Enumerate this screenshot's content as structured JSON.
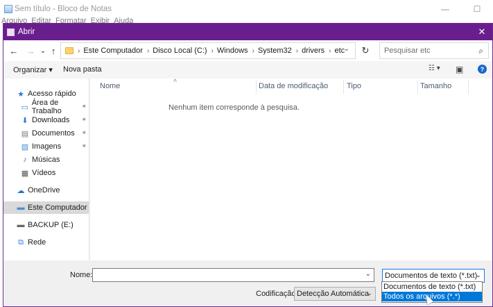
{
  "background_window": {
    "title": "Sem título - Bloco de Notas",
    "menu": [
      "Arquivo",
      "Editar",
      "Formatar",
      "Exibir",
      "Ajuda"
    ],
    "controls": [
      "—",
      "☐"
    ]
  },
  "dialog": {
    "title": "Abrir",
    "close_glyph": "✕",
    "accent": "#6a1e8e"
  },
  "nav": {
    "back": "←",
    "forward": "→",
    "recent": "⌄",
    "up": "↑",
    "breadcrumbs": [
      "Este Computador",
      "Disco Local (C:)",
      "Windows",
      "System32",
      "drivers",
      "etc"
    ],
    "separator": "›",
    "refresh": "↻",
    "search_placeholder": "Pesquisar etc",
    "search_icon": "⌕"
  },
  "toolbar": {
    "organize": "Organizar ▾",
    "new_folder": "Nova pasta",
    "view_icon": "☷ ▾",
    "pane_icon": "▣",
    "help_glyph": "?"
  },
  "sidebar": {
    "items": [
      {
        "label": "Acesso rápido",
        "icon": "★",
        "pinned": false
      },
      {
        "label": "Área de Trabalho",
        "icon": "▭",
        "pinned": true
      },
      {
        "label": "Downloads",
        "icon": "⬇",
        "pinned": true
      },
      {
        "label": "Documentos",
        "icon": "▤",
        "pinned": true
      },
      {
        "label": "Imagens",
        "icon": "▨",
        "pinned": true
      },
      {
        "label": "Músicas",
        "icon": "♪",
        "pinned": false
      },
      {
        "label": "Vídeos",
        "icon": "▦",
        "pinned": false
      },
      {
        "label": "OneDrive",
        "icon": "☁",
        "pinned": false
      },
      {
        "label": "Este Computador",
        "icon": "▬",
        "pinned": false
      },
      {
        "label": "BACKUP (E:)",
        "icon": "▬",
        "pinned": false
      },
      {
        "label": "Rede",
        "icon": "⧉",
        "pinned": false
      }
    ],
    "pin_glyph": "📌"
  },
  "content": {
    "columns": [
      "Nome",
      "Data de modificação",
      "Tipo",
      "Tamanho"
    ],
    "sort_caret": "˄",
    "empty_message": "Nenhum item corresponde à pesquisa."
  },
  "bottom": {
    "name_label": "Nome:",
    "name_value": "",
    "file_type_selected": "Documentos de texto (*.txt)",
    "file_type_options": [
      "Documentos de texto (*.txt)",
      "Todos os arquivos  (*.*)"
    ],
    "encoding_label": "Codificação:",
    "encoding_value": "Detecção Automática",
    "dropdown_glyph": "⌄"
  }
}
